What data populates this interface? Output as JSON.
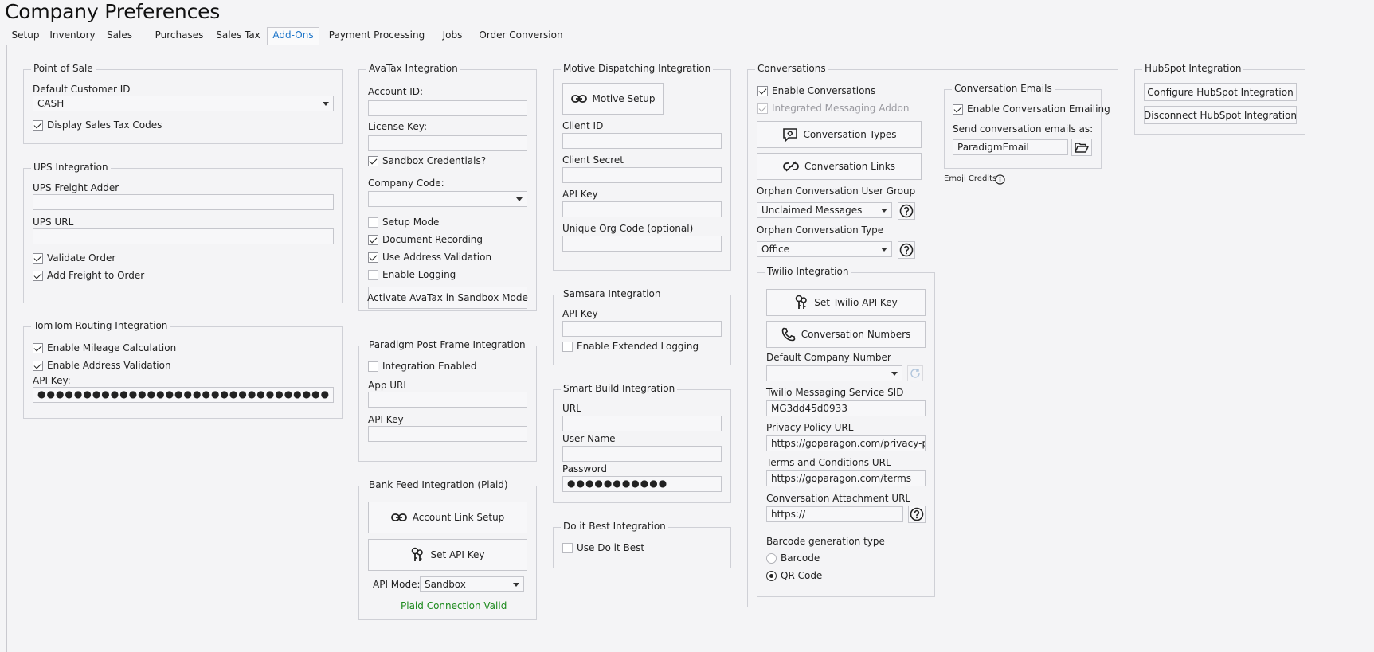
{
  "window": {
    "title": "Company Preferences"
  },
  "tabs": [
    {
      "label": "Setup"
    },
    {
      "label": "Inventory"
    },
    {
      "label": "Sales"
    },
    {
      "label": "Purchases"
    },
    {
      "label": "Sales Tax"
    },
    {
      "label": "Add-Ons"
    },
    {
      "label": "Payment Processing"
    },
    {
      "label": "Jobs"
    },
    {
      "label": "Order Conversion"
    }
  ],
  "active_tab": "Add-Ons",
  "pos": {
    "title": "Point of Sale",
    "customer_label": "Default Customer ID",
    "customer_value": "CASH",
    "display_tax_label": "Display Sales Tax Codes",
    "display_tax_checked": true
  },
  "ups": {
    "title": "UPS Integration",
    "freight_label": "UPS Freight Adder",
    "freight_value": "",
    "url_label": "UPS URL",
    "url_value": "",
    "validate_label": "Validate Order",
    "validate_checked": true,
    "add_freight_label": "Add Freight to Order",
    "add_freight_checked": true
  },
  "tomtom": {
    "title": "TomTom Routing Integration",
    "mileage_label": "Enable Mileage Calculation",
    "mileage_checked": true,
    "address_label": "Enable Address Validation",
    "address_checked": true,
    "api_key_label": "API Key:",
    "api_key_value": "●●●●●●●●●●●●●●●●●●●●●●●●●●●●●●●●"
  },
  "avatax": {
    "title": "AvaTax Integration",
    "account_label": "Account ID:",
    "account_value": "",
    "license_label": "License Key:",
    "license_value": "",
    "sandbox_label": "Sandbox Credentials?",
    "sandbox_checked": true,
    "company_label": "Company Code:",
    "company_value": "",
    "setup_mode_label": "Setup Mode",
    "setup_mode_checked": false,
    "doc_recording_label": "Document Recording",
    "doc_recording_checked": true,
    "address_validation_label": "Use Address Validation",
    "address_validation_checked": true,
    "logging_label": "Enable Logging",
    "logging_checked": false,
    "activate_button": "Activate AvaTax in Sandbox Mode"
  },
  "postframe": {
    "title": "Paradigm Post Frame Integration",
    "enabled_label": "Integration Enabled",
    "enabled_checked": false,
    "app_url_label": "App URL",
    "app_url_value": "",
    "api_key_label": "API Key",
    "api_key_value": ""
  },
  "bankfeed": {
    "title": "Bank Feed Integration (Plaid)",
    "link_button": "Account Link Setup",
    "api_key_button": "Set API Key",
    "api_mode_label": "API Mode:",
    "api_mode_value": "Sandbox",
    "status": "Plaid Connection Valid",
    "status_color": "#1d8a1d"
  },
  "motive": {
    "title": "Motive Dispatching Integration",
    "setup_button": "Motive Setup",
    "client_id_label": "Client ID",
    "client_id_value": "",
    "client_secret_label": "Client Secret",
    "client_secret_value": "",
    "api_key_label": "API Key",
    "api_key_value": "",
    "org_code_label": "Unique Org Code (optional)",
    "org_code_value": ""
  },
  "samsara": {
    "title": "Samsara Integration",
    "api_key_label": "API Key",
    "api_key_value": "",
    "ext_logging_label": "Enable Extended Logging",
    "ext_logging_checked": false
  },
  "smartbuild": {
    "title": "Smart Build Integration",
    "url_label": "URL",
    "url_value": "",
    "username_label": "User Name",
    "username_value": "",
    "password_label": "Password",
    "password_value": "●●●●●●●●●●●"
  },
  "doitbest": {
    "title": "Do it Best Integration",
    "use_label": "Use Do it Best",
    "use_checked": false
  },
  "conversations": {
    "title": "Conversations",
    "enable_label": "Enable Conversations",
    "enable_checked": true,
    "messaging_label": "Integrated Messaging Addon",
    "messaging_checked": true,
    "types_button": "Conversation Types",
    "links_button": "Conversation Links",
    "orphan_group_label": "Orphan Conversation User Group",
    "orphan_group_value": "Unclaimed Messages",
    "orphan_type_label": "Orphan Conversation Type",
    "orphan_type_value": "Office",
    "emails": {
      "title": "Conversation Emails",
      "enable_label": "Enable Conversation Emailing",
      "enable_checked": true,
      "send_as_label": "Send conversation emails as:",
      "send_as_value": "ParadigmEmail"
    },
    "emoji_credits": "Emoji Credits",
    "twilio": {
      "title": "Twilio Integration",
      "api_key_button": "Set Twilio API Key",
      "numbers_button": "Conversation Numbers",
      "default_number_label": "Default Company Number",
      "default_number_value": "",
      "sid_label": "Twilio Messaging Service SID",
      "sid_value": "MG3dd45d0933",
      "privacy_label": "Privacy Policy URL",
      "privacy_value": "https://goparagon.com/privacy-policy",
      "terms_label": "Terms and Conditions URL",
      "terms_value": "https://goparagon.com/terms",
      "attachment_label": "Conversation Attachment URL",
      "attachment_value": "https://",
      "barcode_label": "Barcode generation type",
      "barcode_options": [
        "Barcode",
        "QR Code"
      ],
      "barcode_selected": "QR Code"
    }
  },
  "hubspot": {
    "title": "HubSpot Integration",
    "configure_button": "Configure HubSpot Integration",
    "disconnect_button": "Disconnect HubSpot Integration"
  }
}
